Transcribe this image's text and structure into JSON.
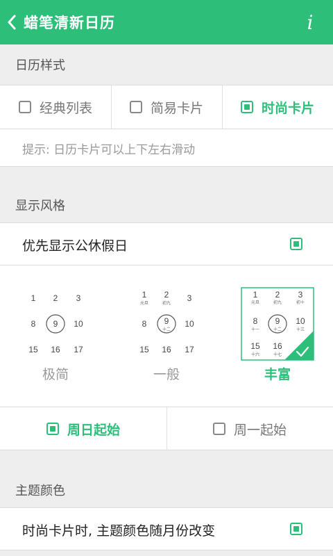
{
  "header": {
    "title": "蜡笔清新日历",
    "info_icon": "i"
  },
  "calendar_style": {
    "section_title": "日历样式",
    "options": [
      {
        "label": "经典列表",
        "checked": false
      },
      {
        "label": "简易卡片",
        "checked": false
      },
      {
        "label": "时尚卡片",
        "checked": true
      }
    ],
    "hint": "提示: 日历卡片可以上下左右滑动"
  },
  "display_style": {
    "section_title": "显示风格",
    "holiday_pref": {
      "label": "优先显示公休假日",
      "checked": true
    },
    "styles": [
      {
        "name": "极简",
        "selected": false
      },
      {
        "name": "一般",
        "selected": false
      },
      {
        "name": "丰富",
        "selected": true
      }
    ],
    "preview_days": [
      [
        "1",
        "2",
        "3"
      ],
      [
        "8",
        "9",
        "10"
      ],
      [
        "15",
        "16",
        "17"
      ]
    ],
    "preview_lunar": [
      [
        "元旦",
        "初九",
        "初十"
      ],
      [
        "十一",
        "十二",
        "十三"
      ],
      [
        "十六",
        "十七",
        ""
      ]
    ],
    "week_start": [
      {
        "label": "周日起始",
        "checked": true
      },
      {
        "label": "周一起始",
        "checked": false
      }
    ]
  },
  "theme_color": {
    "section_title": "主题颜色",
    "follow_month": {
      "label": "时尚卡片时, 主题颜色随月份改变",
      "checked": true
    }
  },
  "colors": {
    "accent": "#2dbf7a",
    "bg": "#eeeeee"
  }
}
